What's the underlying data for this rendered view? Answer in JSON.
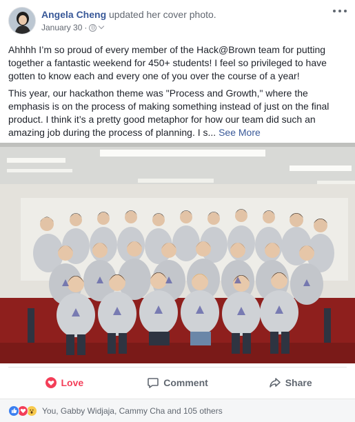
{
  "post": {
    "author": "Angela Cheng",
    "action": " updated her cover photo.",
    "date": "January 30",
    "privacy_icon": "globe-icon",
    "menu_icon": "more-options-icon",
    "paragraph1": "Ahhhh I’m so proud of every member of the Hack@Brown team for putting together a fantastic weekend for 450+ students! I feel so privileged to have gotten to know each and every one of you over the course of a year!",
    "paragraph2": "This year, our hackathon theme was \"Process and Growth,\" where the emphasis is on the process of making something instead of just on the final product. I think it’s a pretty good metaphor for how our team did such an amazing job during the process of planning. I s...",
    "see_more": "See More"
  },
  "actions": {
    "love": "Love",
    "comment": "Comment",
    "share": "Share"
  },
  "reactions": {
    "icons": [
      "like-reaction-icon",
      "love-reaction-icon",
      "wow-reaction-icon"
    ],
    "summary": "You, Gabby Widjaja, Cammy Cha and 105 others"
  },
  "colors": {
    "link": "#385898",
    "love": "#f33e58",
    "like": "#3b7ff0",
    "carpet": "#8e1f1d",
    "sweater": "#c9ccd1"
  }
}
